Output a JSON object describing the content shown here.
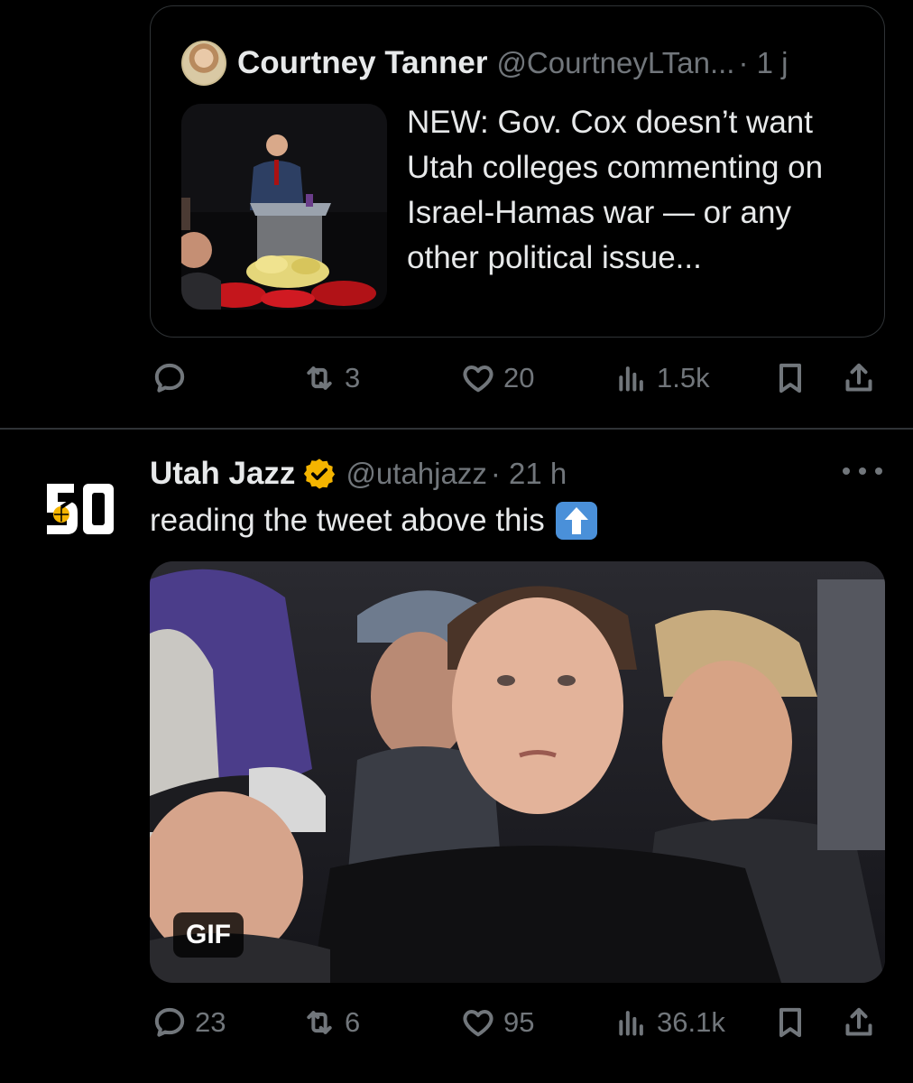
{
  "quoted_tweet": {
    "author_name": "Courtney Tanner",
    "handle": "@CourtneyLTan...",
    "time": "· 1 j",
    "text": "NEW: Gov. Cox doesn’t want Utah colleges commenting on Israel-Hamas war — or any other political issue..."
  },
  "first_actions": {
    "reply_count": "",
    "retweet_count": "3",
    "like_count": "20",
    "views_count": "1.5k"
  },
  "tweet": {
    "author_name": "Utah Jazz",
    "handle": "@utahjazz",
    "time": "· 21 h",
    "text": "reading the tweet above this",
    "emoji": "up-arrow-emoji",
    "media_badge": "GIF"
  },
  "second_actions": {
    "reply_count": "23",
    "retweet_count": "6",
    "like_count": "95",
    "views_count": "36.1k"
  },
  "colors": {
    "background": "#000000",
    "text_primary": "#e7e9ea",
    "text_secondary": "#71767b",
    "border": "#2f3336",
    "verified_gold": "#f4b400"
  }
}
